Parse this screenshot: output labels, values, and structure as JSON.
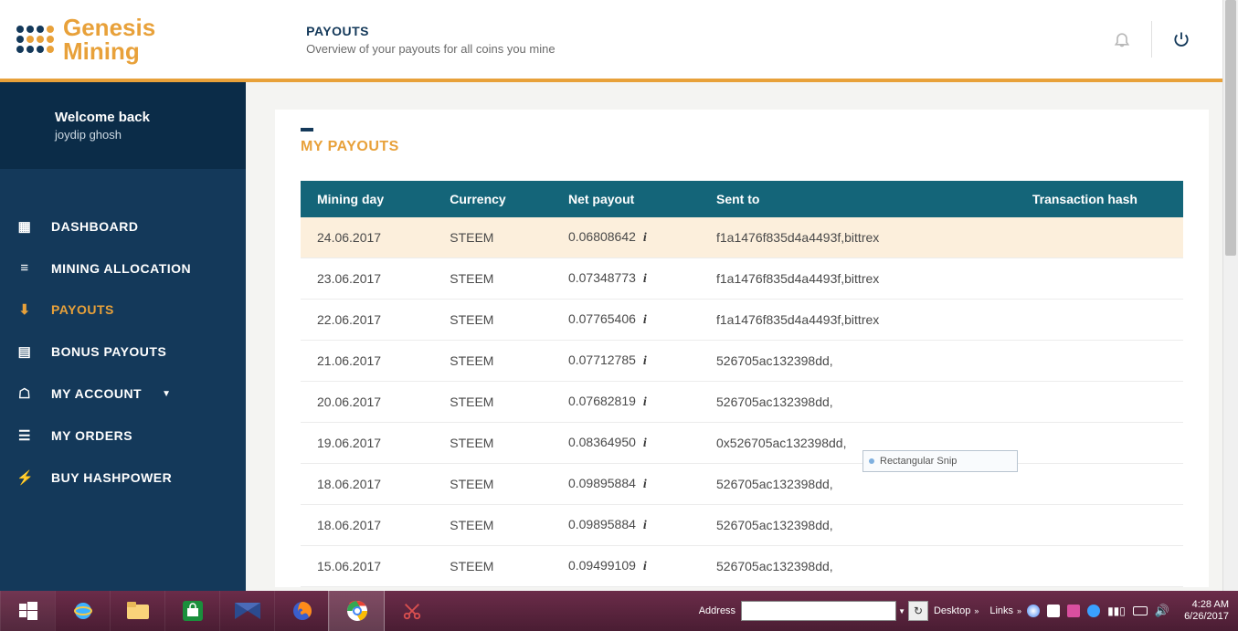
{
  "brand": {
    "name1": "Genesis",
    "name2": "Mining"
  },
  "header": {
    "title": "PAYOUTS",
    "subtitle": "Overview of your payouts for all coins you mine"
  },
  "welcome": {
    "line1": "Welcome back",
    "line2": "joydip ghosh"
  },
  "nav": [
    {
      "label": "DASHBOARD",
      "icon": "dashboard-icon",
      "active": false
    },
    {
      "label": "MINING ALLOCATION",
      "icon": "sliders-icon",
      "active": false
    },
    {
      "label": "PAYOUTS",
      "icon": "download-icon",
      "active": true
    },
    {
      "label": "BONUS PAYOUTS",
      "icon": "grid-icon",
      "active": false
    },
    {
      "label": "MY ACCOUNT",
      "icon": "user-icon",
      "active": false,
      "caret": true
    },
    {
      "label": "MY ORDERS",
      "icon": "list-icon",
      "active": false
    },
    {
      "label": "BUY HASHPOWER",
      "icon": "bolt-icon",
      "active": false
    }
  ],
  "panel": {
    "title": "MY PAYOUTS",
    "columns": {
      "c0": "Mining day",
      "c1": "Currency",
      "c2": "Net payout",
      "c3": "Sent to",
      "c4": "Transaction hash"
    },
    "rows": [
      {
        "day": "24.06.2017",
        "currency": "STEEM",
        "payout": "0.06808642",
        "sent": "f1a1476f835d4a4493f,bittrex",
        "hash": ""
      },
      {
        "day": "23.06.2017",
        "currency": "STEEM",
        "payout": "0.07348773",
        "sent": "f1a1476f835d4a4493f,bittrex",
        "hash": ""
      },
      {
        "day": "22.06.2017",
        "currency": "STEEM",
        "payout": "0.07765406",
        "sent": "f1a1476f835d4a4493f,bittrex",
        "hash": ""
      },
      {
        "day": "21.06.2017",
        "currency": "STEEM",
        "payout": "0.07712785",
        "sent": "526705ac132398dd,",
        "hash": ""
      },
      {
        "day": "20.06.2017",
        "currency": "STEEM",
        "payout": "0.07682819",
        "sent": "526705ac132398dd,",
        "hash": ""
      },
      {
        "day": "19.06.2017",
        "currency": "STEEM",
        "payout": "0.08364950",
        "sent": "0x526705ac132398dd,",
        "hash": ""
      },
      {
        "day": "18.06.2017",
        "currency": "STEEM",
        "payout": "0.09895884",
        "sent": "526705ac132398dd,",
        "hash": ""
      },
      {
        "day": "18.06.2017",
        "currency": "STEEM",
        "payout": "0.09895884",
        "sent": "526705ac132398dd,",
        "hash": ""
      },
      {
        "day": "15.06.2017",
        "currency": "STEEM",
        "payout": "0.09499109",
        "sent": "526705ac132398dd,",
        "hash": ""
      }
    ]
  },
  "snip": {
    "label": "Rectangular Snip"
  },
  "taskbar": {
    "address_label": "Address",
    "address_value": "",
    "desktop": "Desktop",
    "links": "Links",
    "time": "4:28 AM",
    "date": "6/26/2017"
  }
}
